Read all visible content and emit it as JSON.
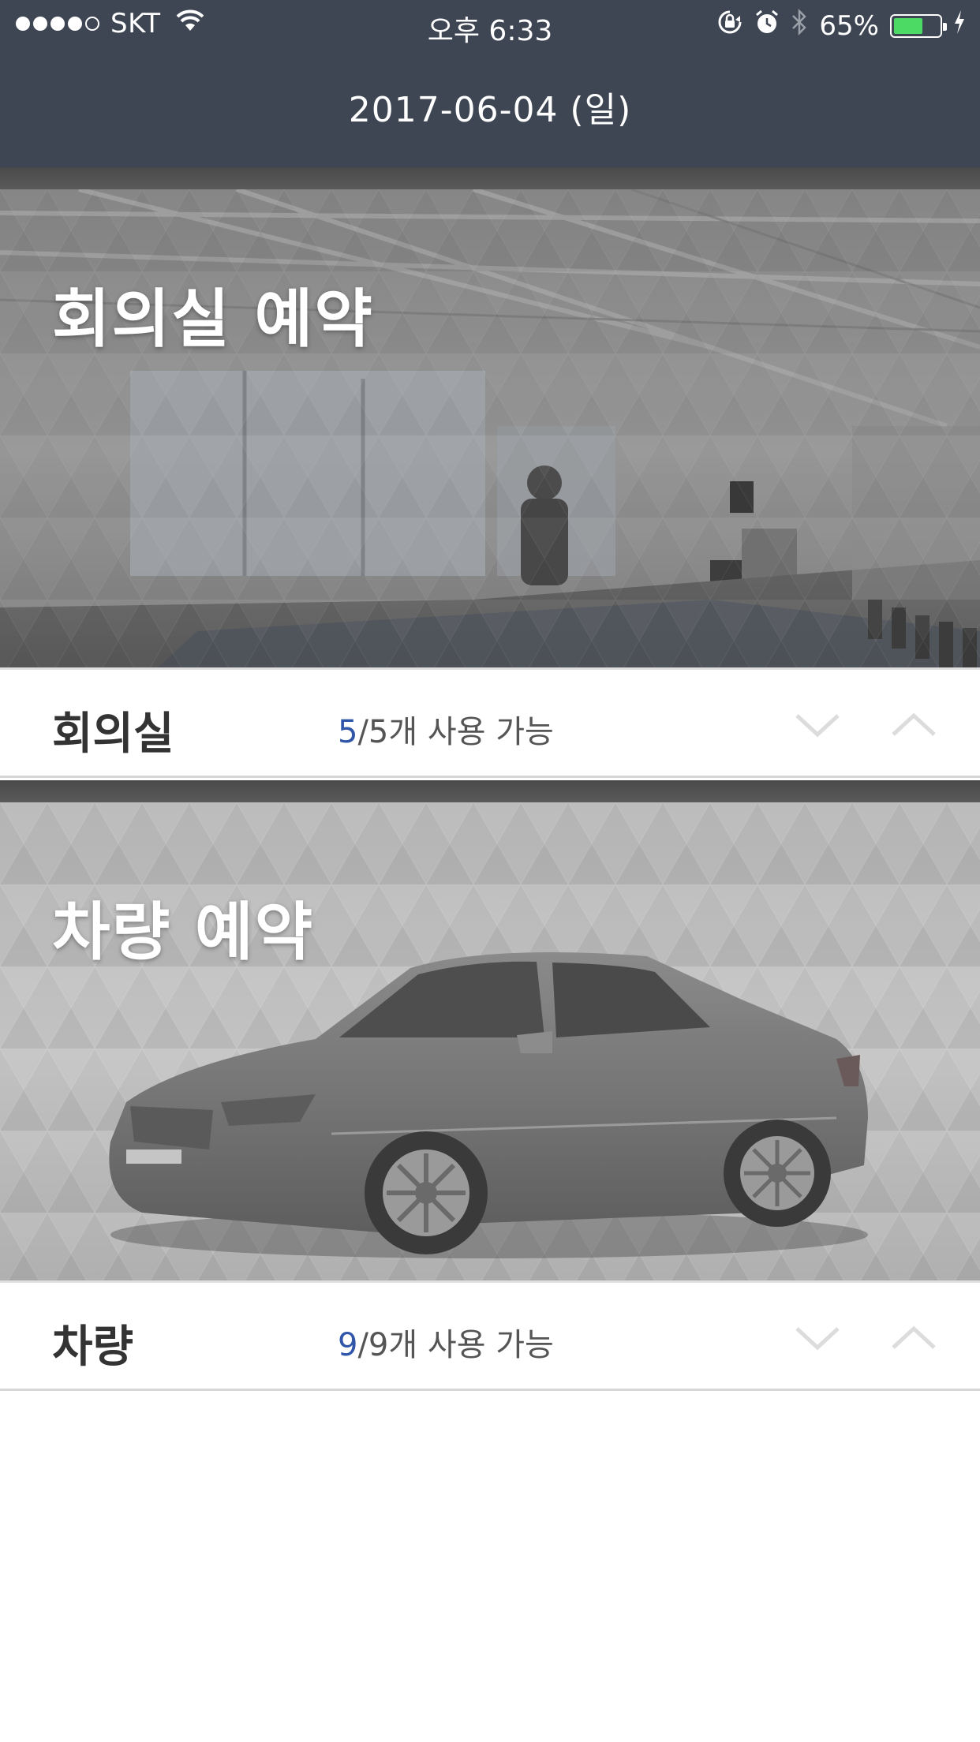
{
  "status_bar": {
    "carrier": "SKT",
    "time": "오후 6:33",
    "battery_percent": "65%",
    "battery_level": 0.65
  },
  "header": {
    "date": "2017-06-04 (일)"
  },
  "cards": [
    {
      "banner_title": "회의실 예약",
      "label": "회의실",
      "available": "5",
      "total_text": "/5개 사용 가능"
    },
    {
      "banner_title": "차량 예약",
      "label": "차량",
      "available": "9",
      "total_text": "/9개 사용 가능"
    }
  ],
  "colors": {
    "header_bg": "#3e4653",
    "accent": "#2f56a8",
    "battery_green": "#4cd964"
  }
}
